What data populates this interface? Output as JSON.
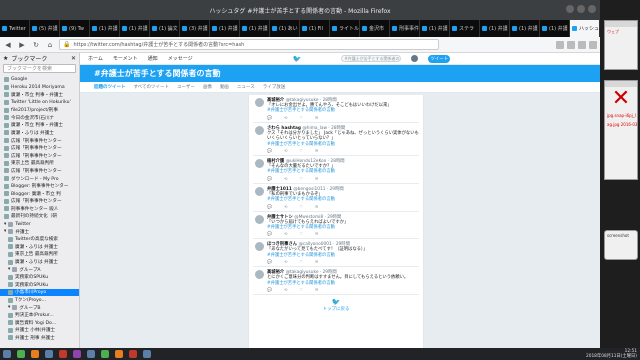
{
  "window": {
    "title": "ハッシュタグ #弁護士が苦手とする関係者の言動 - Mozilla Firefox"
  },
  "tabs": [
    "Twitter",
    "(5) 弁護",
    "(9) Tw",
    "(1) 弁護",
    "(1) 弁護",
    "(1) 論文",
    "(3) 弁護",
    "(1) 弁護",
    "(1) 弁護",
    "(1) あい",
    "(1) Fil",
    "ライトル",
    "金沢市",
    "刑事事件",
    "(1) 弁護",
    "ステラ",
    "(1) 弁護",
    "(1) 弁護",
    "(1) 弁護",
    "ハッシュ"
  ],
  "nav": {
    "url": "https://twitter.com/hashtag/弁護士が苦手とする関係者の言動?src=hash"
  },
  "sidebar": {
    "title": "ブックマーク",
    "search_placeholder": "ブックマークを検索",
    "items": [
      {
        "label": "Google",
        "type": "item"
      },
      {
        "label": "Heroku 2014 Moriyama",
        "type": "item"
      },
      {
        "label": "廣瀬・市立 判事・弁護士",
        "type": "item"
      },
      {
        "label": "Twitter 'Little on Hokuriku'",
        "type": "item"
      },
      {
        "label": "file2017/project/刑事",
        "type": "item"
      },
      {
        "label": "今日の金沢市(石川ナ",
        "type": "item"
      },
      {
        "label": "廣瀬・市立 判事・弁護士",
        "type": "item"
      },
      {
        "label": "廣瀬・ふりは 弁護士",
        "type": "item"
      },
      {
        "label": "広報「刑事事件センター",
        "type": "item"
      },
      {
        "label": "広報「刑事事件センター",
        "type": "item"
      },
      {
        "label": "広報「刑事事件センター",
        "type": "item"
      },
      {
        "label": "東京上告 最高裁判所",
        "type": "item"
      },
      {
        "label": "広報「刑事事件センター",
        "type": "item"
      },
      {
        "label": "ダウンロード - My Pro",
        "type": "item"
      },
      {
        "label": "Blogger: 刑事事件センター",
        "type": "item"
      },
      {
        "label": "Blogger: 廣瀬・市立 判",
        "type": "item"
      },
      {
        "label": "広報「刑事事件センター",
        "type": "item"
      },
      {
        "label": "刑事事件センター 殿人",
        "type": "item"
      },
      {
        "label": "最新刊の持続文化（研",
        "type": "item"
      },
      {
        "label": "Twitter",
        "type": "folder"
      },
      {
        "label": "弁護士",
        "type": "folder"
      },
      {
        "label": "Twitterの高度な検索",
        "type": "item"
      },
      {
        "label": "廣瀬・ふりは 弁護士",
        "type": "item"
      },
      {
        "label": "東京上告 最高裁判所",
        "type": "item"
      },
      {
        "label": "廣瀬・ふりは 弁護士",
        "type": "item"
      },
      {
        "label": "グループA",
        "type": "folder"
      },
      {
        "label": "実務家のSPUKu",
        "type": "item"
      },
      {
        "label": "実務家のSPUKu",
        "type": "item"
      },
      {
        "label": "小島市川Proyo",
        "type": "selected"
      },
      {
        "label": "Tクン(Proyo...",
        "type": "item"
      },
      {
        "label": "グループB",
        "type": "folder"
      },
      {
        "label": "判決正本(Prokur...",
        "type": "item"
      },
      {
        "label": "廣告資料 Yogi Do...",
        "type": "item"
      },
      {
        "label": "弁護士 小林(弁護士",
        "type": "item"
      },
      {
        "label": "弁護士 刑事 弁護士",
        "type": "item"
      }
    ]
  },
  "twitter": {
    "nav_home": "ホーム",
    "nav_moments": "モーメント",
    "nav_notifications": "通知",
    "nav_messages": "メッセージ",
    "search_placeholder": "#弁護士が苦手とする関係者の言動",
    "tweet_button": "ツイート",
    "hashtag_title": "#弁護士が苦手とする関係者の言動",
    "tabs": [
      "話題のツイート",
      "すべてのツイート",
      "ユーザー",
      "画像",
      "動画",
      "ニュース",
      "ライブ放送"
    ],
    "tweets": [
      {
        "name": "高城裕介",
        "handle": "@takagiyusuke · 28時間",
        "text": "「オレにお金出せよ。勝てんやろ、そこどもはいいわけだ以来」",
        "tag": "#弁護士が苦手とする関係者の言動"
      },
      {
        "name": "さわら hashtag",
        "handle": "@hima_law · 28時間",
        "text": "クス「それは分かりました」\nJack「じゃあね、ぜっというくらい実体がないもいくらいくらいとっていらない？」",
        "tag": "#弁護士が苦手とする関係者の言動"
      },
      {
        "name": "植村介護",
        "handle": "@ukiHondo12eKon · 28時間",
        "text": "「そんなの大量だるたいですか？」",
        "tag": "#弁護士が苦手とする関係者の言動"
      },
      {
        "name": "弁護士1011",
        "handle": "@bengosi1011 · 29時間",
        "text": "「私の刑事でいまもかるぞ」",
        "tag": "#弁護士が苦手とする関係者の言動"
      },
      {
        "name": "弁護士サトシ",
        "handle": "@Mwestomi8 · 29時間",
        "text": "「いつから届けてもらえればよいですか」",
        "tag": "#弁護士が苦手とする関係者の言動"
      },
      {
        "name": "ほつき刑事さん",
        "handle": "@callyono0001 · 29時間",
        "text": "「あなたがいって見てもたべてす！（証明はなる）」",
        "tag": "#弁護士が苦手とする関係者の言動"
      },
      {
        "name": "高城裕介",
        "handle": "@takagiyusuke · 29時間",
        "text": "とにかくご意味分の判断はすすません。目にしてもらえるという依頼い。",
        "tag": "#弁護士が苦手とする関係者の言動"
      }
    ],
    "reply_count": "1",
    "retweet_count": "",
    "like_count": "",
    "load_more": "トップに戻る"
  },
  "rightpanel": {
    "card1_title": "ウェブ",
    "card2_text": "jpg.snap-i6pj_l",
    "card3_text": "ag.jpg 2016-03",
    "card4_text": "screenshot"
  },
  "taskbar": {
    "time": "12:51",
    "date": "2018年08月11日(土曜日)"
  }
}
